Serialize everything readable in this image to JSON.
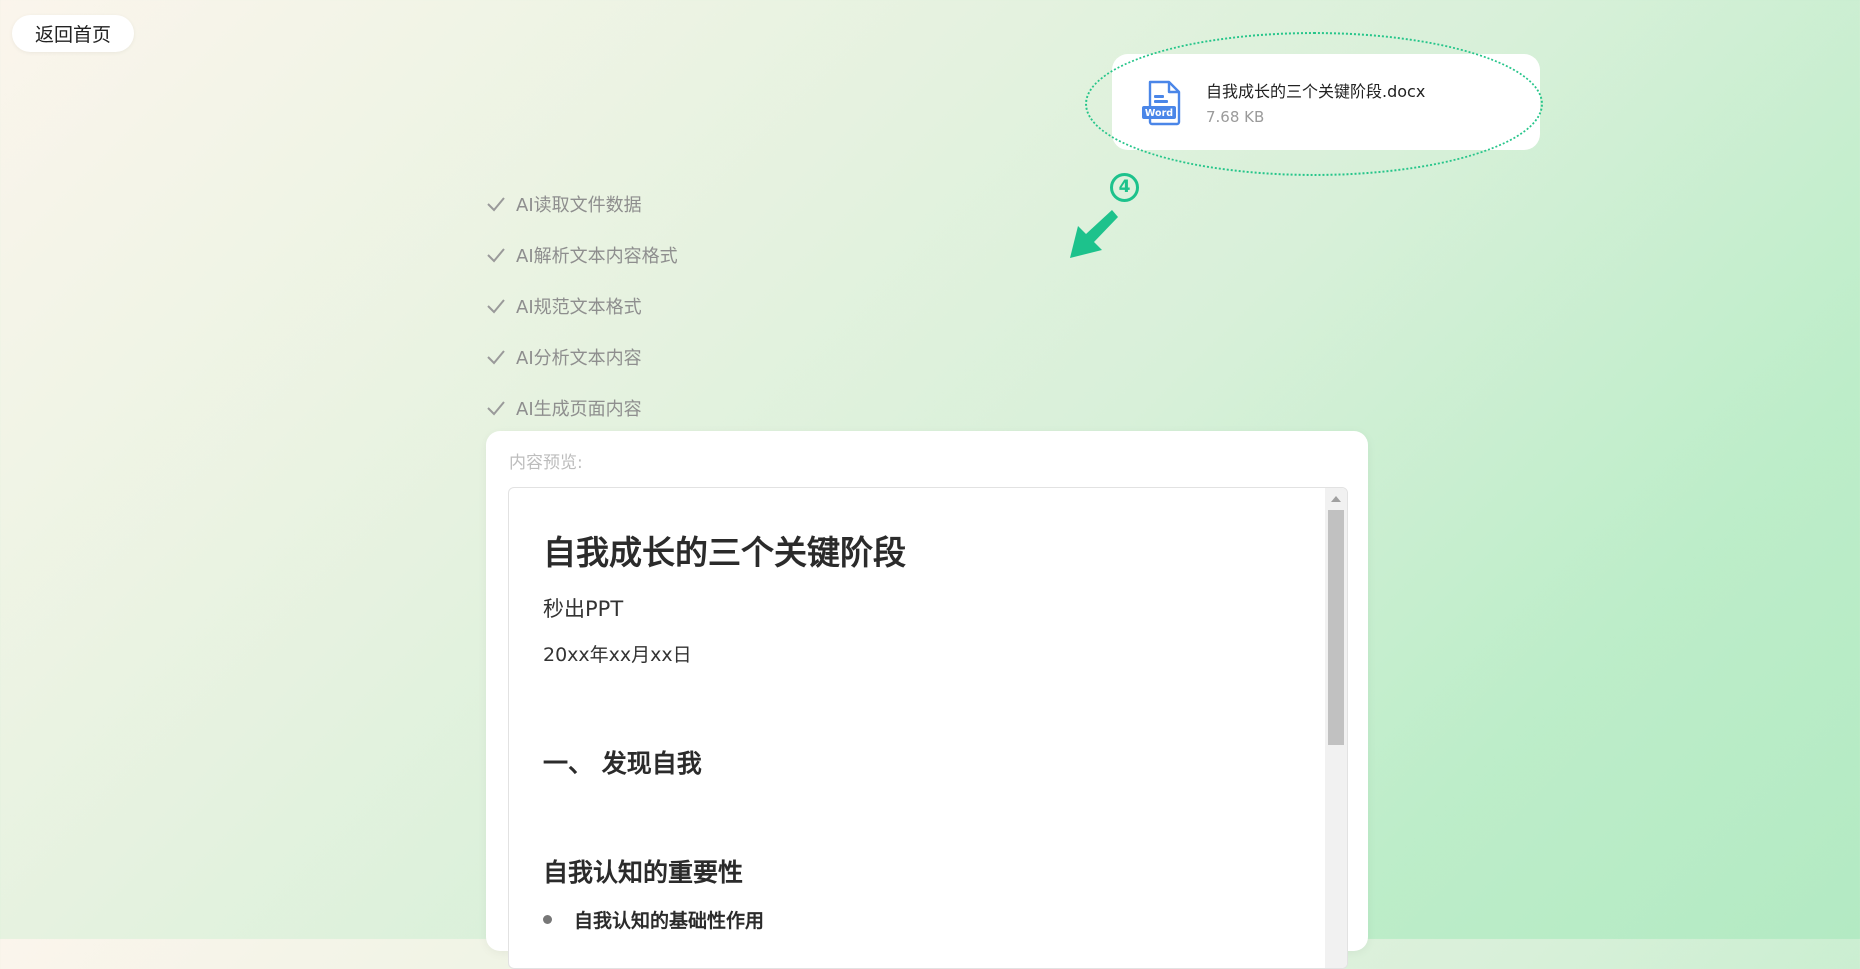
{
  "nav": {
    "back_label": "返回首页"
  },
  "file": {
    "name": "自我成长的三个关键阶段.docx",
    "size": "7.68 KB",
    "icon": "word-document-icon",
    "icon_badge": "Word",
    "accent": "#4a86e8"
  },
  "annotation": {
    "step_number": "4",
    "color": "#1dc28c"
  },
  "steps": [
    {
      "label": "AI读取文件数据",
      "done": true
    },
    {
      "label": "AI解析文本内容格式",
      "done": true
    },
    {
      "label": "AI规范文本格式",
      "done": true
    },
    {
      "label": "AI分析文本内容",
      "done": true
    },
    {
      "label": "AI生成页面内容",
      "done": true
    }
  ],
  "preview": {
    "label": "内容预览:",
    "doc": {
      "title": "自我成长的三个关键阶段",
      "subtitle": "秒出PPT",
      "date": "20xx年xx月xx日",
      "section_heading": "一、 发现自我",
      "subsection_heading": "自我认知的重要性",
      "bullets": [
        "自我认知的基础性作用"
      ]
    }
  }
}
